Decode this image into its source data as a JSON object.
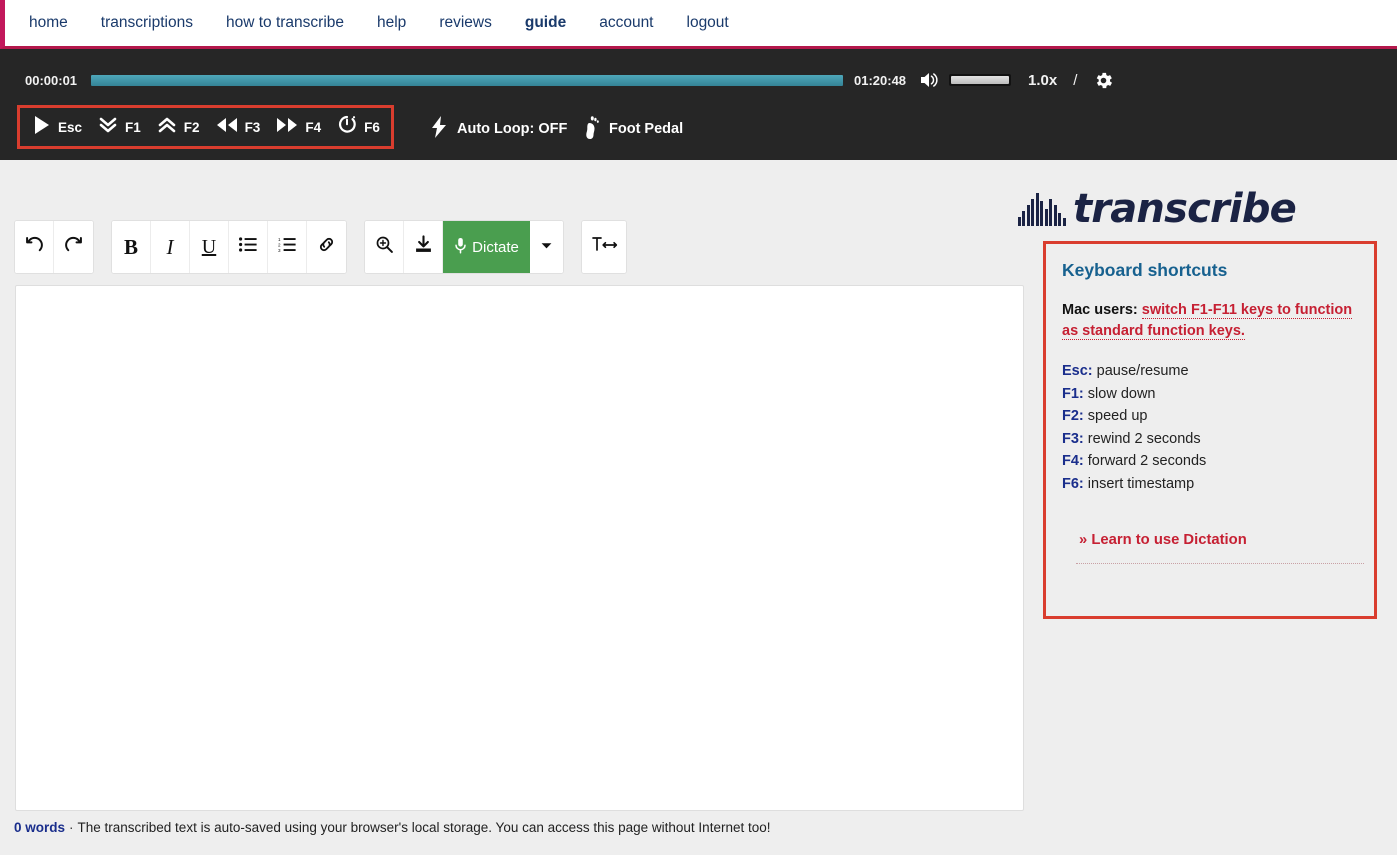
{
  "nav": {
    "items": [
      {
        "label": "home",
        "bold": false
      },
      {
        "label": "transcriptions",
        "bold": false
      },
      {
        "label": "how to transcribe",
        "bold": false
      },
      {
        "label": "help",
        "bold": false
      },
      {
        "label": "reviews",
        "bold": false
      },
      {
        "label": "guide",
        "bold": true
      },
      {
        "label": "account",
        "bold": false
      },
      {
        "label": "logout",
        "bold": false
      }
    ]
  },
  "player": {
    "current_time": "00:00:01",
    "total_time": "01:20:48",
    "progress_percent": 100,
    "volume_percent": 100,
    "speed": "1.0x",
    "separator": "/",
    "speaker_icon": "speaker-icon",
    "gear_icon": "gear-icon",
    "controls": [
      {
        "icon": "play-icon",
        "key": "Esc"
      },
      {
        "icon": "double-chevron-down-icon",
        "key": "F1"
      },
      {
        "icon": "double-chevron-up-icon",
        "key": "F2"
      },
      {
        "icon": "rewind-icon",
        "key": "F3"
      },
      {
        "icon": "fast-forward-icon",
        "key": "F4"
      },
      {
        "icon": "stopwatch-icon",
        "key": "F6"
      }
    ],
    "auto_loop": {
      "icon": "lightning-bolt-icon",
      "label": "Auto Loop: OFF"
    },
    "foot_pedal": {
      "icon": "footprint-icon",
      "label": "Foot Pedal"
    }
  },
  "logo": {
    "text": "transcribe",
    "icon": "waveform-icon"
  },
  "toolbar": {
    "groups": [
      {
        "buttons": [
          {
            "name": "undo-button",
            "icon": "undo-icon",
            "glyph": "↺"
          },
          {
            "name": "redo-button",
            "icon": "redo-icon",
            "glyph": "↻"
          }
        ]
      },
      {
        "buttons": [
          {
            "name": "bold-button",
            "icon": "bold-icon",
            "glyph": "B"
          },
          {
            "name": "italic-button",
            "icon": "italic-icon",
            "glyph": "I"
          },
          {
            "name": "underline-button",
            "icon": "underline-icon",
            "glyph": "U"
          },
          {
            "name": "bullet-list-button",
            "icon": "bullet-list-icon",
            "glyph": "☰"
          },
          {
            "name": "numbered-list-button",
            "icon": "numbered-list-icon",
            "glyph": "☰"
          },
          {
            "name": "link-button",
            "icon": "link-icon",
            "glyph": "🔗"
          }
        ]
      },
      {
        "buttons": [
          {
            "name": "zoom-button",
            "icon": "magnifier-plus-icon",
            "glyph": "🔍"
          },
          {
            "name": "download-button",
            "icon": "download-icon",
            "glyph": "⬇"
          },
          {
            "name": "dictate-button",
            "icon": "microphone-icon",
            "label": "Dictate"
          },
          {
            "name": "dictate-options-button",
            "icon": "chevron-down-icon",
            "glyph": "▾"
          }
        ]
      },
      {
        "buttons": [
          {
            "name": "text-width-button",
            "icon": "text-width-icon",
            "glyph": "T↔"
          }
        ]
      }
    ],
    "dictate_label": "Dictate",
    "dictate_color": "#4a9e4f"
  },
  "editor": {
    "content": "",
    "placeholder": ""
  },
  "footer": {
    "word_count": "0 words",
    "separator": "·",
    "note": "The transcribed text is auto-saved using your browser's local storage. You can access this page without Internet too!"
  },
  "shortcuts": {
    "title": "Keyboard shortcuts",
    "mac_prefix": "Mac users:",
    "mac_link": "switch F1-F11 keys to function as standard function keys.",
    "items": [
      {
        "key": "Esc:",
        "desc": "pause/resume"
      },
      {
        "key": "F1:",
        "desc": "slow down"
      },
      {
        "key": "F2:",
        "desc": "speed up"
      },
      {
        "key": "F3:",
        "desc": "rewind 2 seconds"
      },
      {
        "key": "F4:",
        "desc": "forward 2 seconds"
      },
      {
        "key": "F6:",
        "desc": "insert timestamp"
      }
    ],
    "learn_link": "» Learn to use Dictation"
  },
  "colors": {
    "accent_red": "#d93d2e",
    "nav_link": "#1a3a6b",
    "nav_border": "#b4184c",
    "player_bg": "#262626",
    "progress_teal": "#3f93a6",
    "dictate_green": "#4a9e4f",
    "link_red": "#c62033",
    "heading_blue": "#17618f"
  }
}
